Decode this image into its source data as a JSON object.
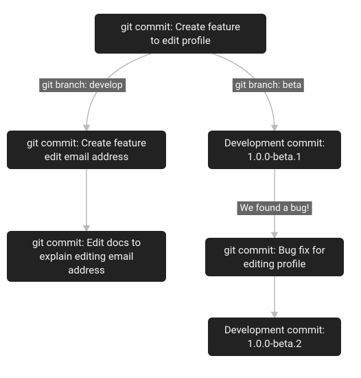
{
  "nodes": {
    "root": {
      "line1": "git commit: Create feature",
      "line2": "to edit profile"
    },
    "develop1": {
      "line1": "git commit: Create feature",
      "line2": "edit email address"
    },
    "develop2": {
      "line1": "git commit: Edit docs to",
      "line2": "explain editing email",
      "line3": "address"
    },
    "beta1": {
      "line1": "Development commit:",
      "line2": "1.0.0-beta.1"
    },
    "beta2": {
      "line1": "git commit: Bug fix for",
      "line2": "editing profile"
    },
    "beta3": {
      "line1": "Development commit:",
      "line2": "1.0.0-beta.2"
    }
  },
  "edgeLabels": {
    "branchDevelop": "git branch: develop",
    "branchBeta": "git branch: beta",
    "bug": "We found a bug!"
  }
}
